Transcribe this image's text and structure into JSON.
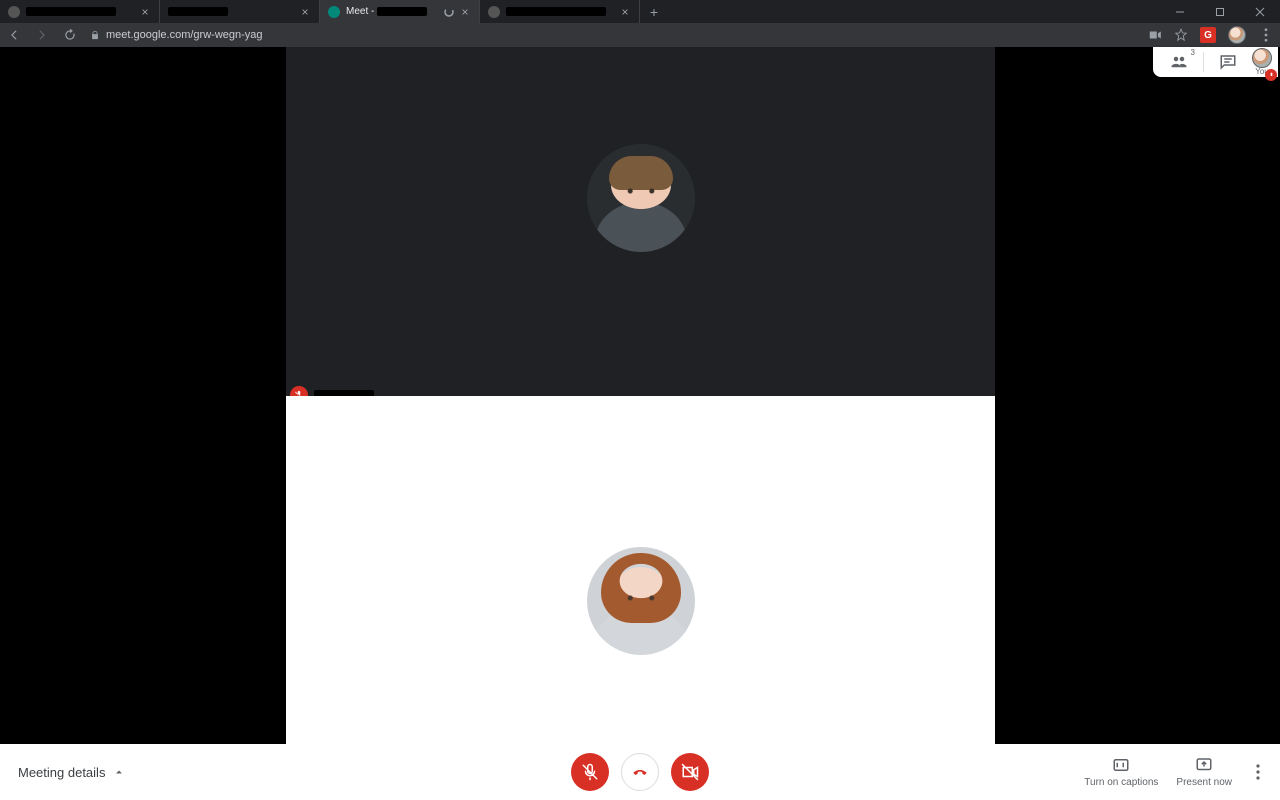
{
  "browser": {
    "tabs": [
      {
        "title_redacted": true,
        "active": false
      },
      {
        "title_redacted": true,
        "active": false
      },
      {
        "prefix": "Meet - ",
        "title_redacted": true,
        "active": true,
        "loading": true,
        "favicon": "meet"
      },
      {
        "title_redacted": true,
        "active": false
      }
    ],
    "url": "meet.google.com/grw-wegn-yag"
  },
  "panel": {
    "participant_count": "3",
    "self_label": "You"
  },
  "participants": [
    {
      "id": "p1",
      "name_redacted": true,
      "muted": true
    },
    {
      "id": "p2"
    }
  ],
  "bottom": {
    "meeting_details": "Meeting details",
    "captions": "Turn on captions",
    "present": "Present now"
  }
}
